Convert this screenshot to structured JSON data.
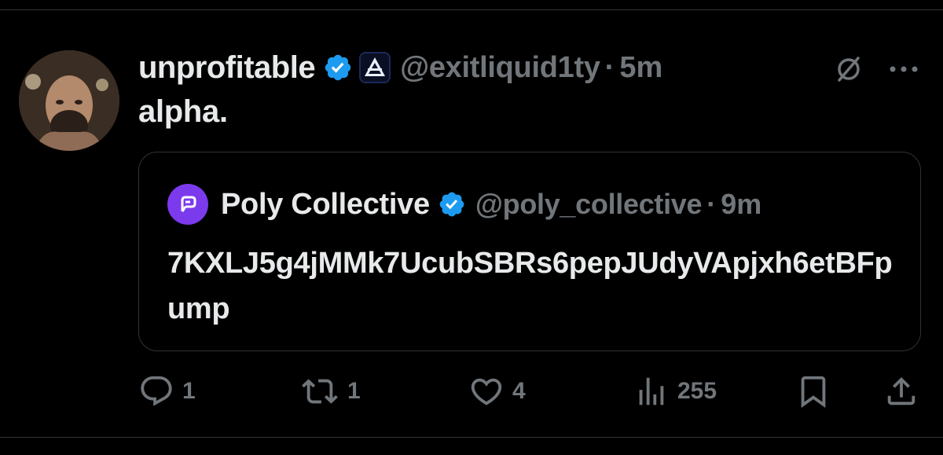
{
  "tweet": {
    "display_name": "unprofitable",
    "handle": "@exitliquid1ty",
    "separator": "·",
    "time": "5m",
    "text": "alpha."
  },
  "quote": {
    "display_name": "Poly Collective",
    "handle": "@poly_collective",
    "separator": "·",
    "time": "9m",
    "text": "7KXLJ5g4jMMk7UcubSBRs6pepJUdyVApjxh6etBFpump"
  },
  "actions": {
    "replies": "1",
    "reposts": "1",
    "likes": "4",
    "views": "255"
  },
  "icons": {
    "verified": "verified-badge-icon",
    "affiliate": "affiliate-logo-icon",
    "grok": "grok-icon",
    "more": "more-icon",
    "reply": "reply-icon",
    "repost": "repost-icon",
    "like": "heart-icon",
    "views": "views-icon",
    "bookmark": "bookmark-icon",
    "share": "share-icon"
  },
  "colors": {
    "background": "#000000",
    "text": "#e7e9ea",
    "muted": "#71767b",
    "verified": "#1d9bf0",
    "border": "#2f3336",
    "quote_avatar": "#7c3aed"
  }
}
